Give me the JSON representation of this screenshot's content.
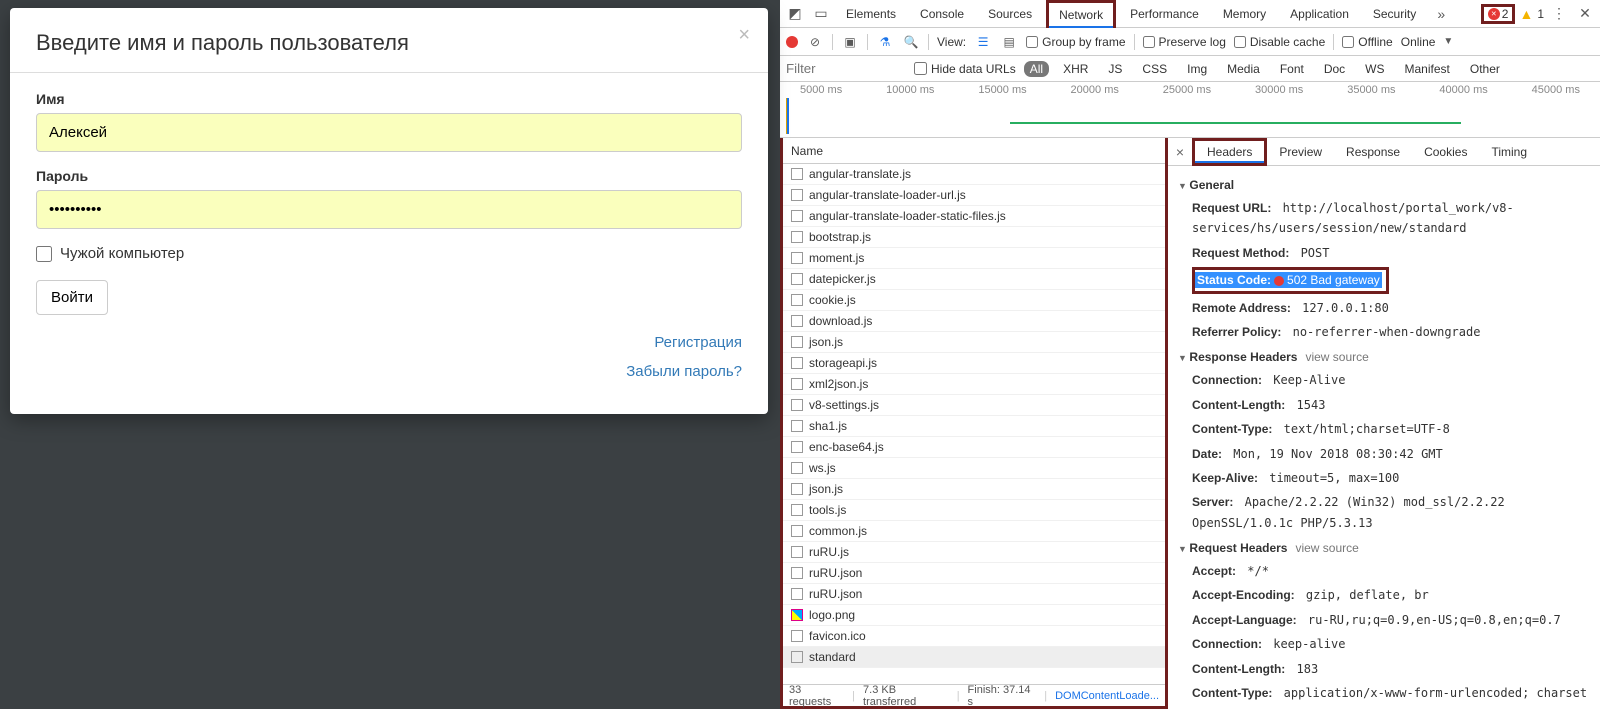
{
  "login": {
    "title": "Введите имя и пароль пользователя",
    "name_label": "Имя",
    "name_value": "Алексей",
    "pass_label": "Пароль",
    "pass_value": "••••••••••",
    "foreign_label": "Чужой компьютер",
    "submit_label": "Войти",
    "register_link": "Регистрация",
    "forgot_link": "Забыли пароль?"
  },
  "devtools": {
    "tabs": [
      "Elements",
      "Console",
      "Sources",
      "Network",
      "Performance",
      "Memory",
      "Application",
      "Security"
    ],
    "active_tab": "Network",
    "errors": "2",
    "warns": "1",
    "toolbar": {
      "view_label": "View:",
      "group_frame": "Group by frame",
      "preserve_log": "Preserve log",
      "disable_cache": "Disable cache",
      "offline": "Offline",
      "online": "Online"
    },
    "filter": {
      "placeholder": "Filter",
      "hide_urls": "Hide data URLs",
      "types": [
        "All",
        "XHR",
        "JS",
        "CSS",
        "Img",
        "Media",
        "Font",
        "Doc",
        "WS",
        "Manifest",
        "Other"
      ]
    },
    "timeline_ticks": [
      "5000 ms",
      "10000 ms",
      "15000 ms",
      "20000 ms",
      "25000 ms",
      "30000 ms",
      "35000 ms",
      "40000 ms",
      "45000 ms"
    ],
    "name_col": "Name",
    "requests": [
      "angular-translate.js",
      "angular-translate-loader-url.js",
      "angular-translate-loader-static-files.js",
      "bootstrap.js",
      "moment.js",
      "datepicker.js",
      "cookie.js",
      "download.js",
      "json.js",
      "storageapi.js",
      "xml2json.js",
      "v8-settings.js",
      "sha1.js",
      "enc-base64.js",
      "ws.js",
      "json.js",
      "tools.js",
      "common.js",
      "ruRU.js",
      "ruRU.json",
      "ruRU.json",
      "logo.png",
      "favicon.ico",
      "standard"
    ],
    "status_bar": {
      "requests": "33 requests",
      "transferred": "7.3 KB transferred",
      "finish": "Finish: 37.14 s",
      "domc": "DOMContentLoade..."
    },
    "details": {
      "tabs": [
        "Headers",
        "Preview",
        "Response",
        "Cookies",
        "Timing"
      ],
      "general_label": "General",
      "response_headers_label": "Response Headers",
      "request_headers_label": "Request Headers",
      "view_source": "view source",
      "general": {
        "Request URL:": "http://localhost/portal_work/v8-services/hs/users/session/new/standard",
        "Request Method:": "POST",
        "Status Code:": "502 Bad gateway",
        "Remote Address:": "127.0.0.1:80",
        "Referrer Policy:": "no-referrer-when-downgrade"
      },
      "response_headers": {
        "Connection:": "Keep-Alive",
        "Content-Length:": "1543",
        "Content-Type:": "text/html;charset=UTF-8",
        "Date:": "Mon, 19 Nov 2018 08:30:42 GMT",
        "Keep-Alive:": "timeout=5, max=100",
        "Server:": "Apache/2.2.22 (Win32) mod_ssl/2.2.22 OpenSSL/1.0.1c PHP/5.3.13"
      },
      "request_headers": {
        "Accept:": "*/*",
        "Accept-Encoding:": "gzip, deflate, br",
        "Accept-Language:": "ru-RU,ru;q=0.9,en-US;q=0.8,en;q=0.7",
        "Connection:": "keep-alive",
        "Content-Length:": "183",
        "Content-Type:": "application/x-www-form-urlencoded; charset"
      }
    }
  }
}
